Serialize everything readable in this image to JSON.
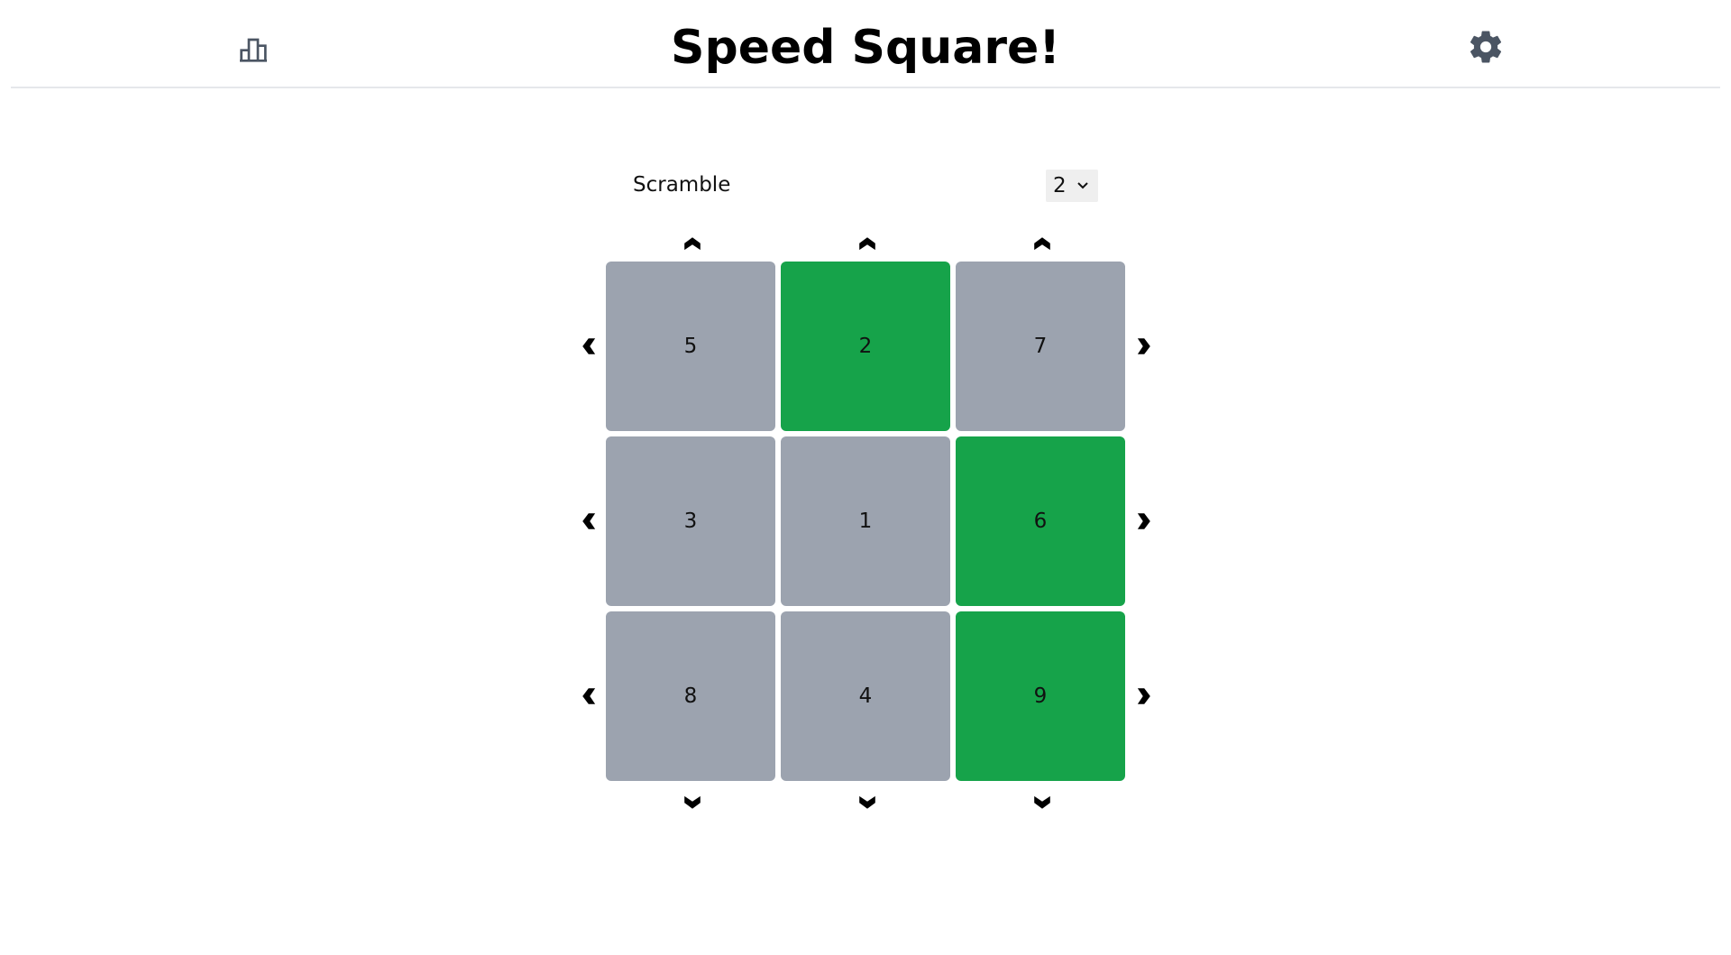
{
  "header": {
    "title": "Speed Square!",
    "stats_icon": "bar-chart-icon",
    "settings_icon": "gear-icon",
    "icon_color": "#4b5563"
  },
  "controls": {
    "scramble_label": "Scramble",
    "scramble_value": "2"
  },
  "colors": {
    "tile_default": "#9ca3af",
    "tile_correct": "#16a34a",
    "arrow": "#000000",
    "divider": "#e5e7eb"
  },
  "grid": {
    "rows": [
      [
        {
          "value": "5",
          "state": "default"
        },
        {
          "value": "2",
          "state": "correct"
        },
        {
          "value": "7",
          "state": "default"
        }
      ],
      [
        {
          "value": "3",
          "state": "default"
        },
        {
          "value": "1",
          "state": "default"
        },
        {
          "value": "6",
          "state": "correct"
        }
      ],
      [
        {
          "value": "8",
          "state": "default"
        },
        {
          "value": "4",
          "state": "default"
        },
        {
          "value": "9",
          "state": "correct"
        }
      ]
    ]
  },
  "arrows": {
    "up": [
      "chevron-up-icon",
      "chevron-up-icon",
      "chevron-up-icon"
    ],
    "down": [
      "chevron-down-icon",
      "chevron-down-icon",
      "chevron-down-icon"
    ],
    "left": [
      "chevron-left-icon",
      "chevron-left-icon",
      "chevron-left-icon"
    ],
    "right": [
      "chevron-right-icon",
      "chevron-right-icon",
      "chevron-right-icon"
    ]
  }
}
